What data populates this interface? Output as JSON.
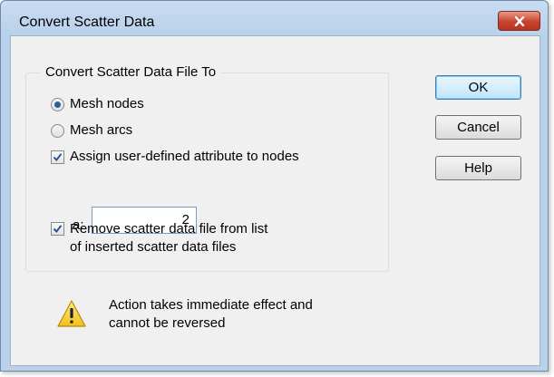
{
  "window": {
    "title": "Convert Scatter Data"
  },
  "group": {
    "title": "Convert Scatter Data File To"
  },
  "options": {
    "mesh_nodes": {
      "label": "Mesh nodes",
      "selected": true
    },
    "mesh_arcs": {
      "label": "Mesh arcs",
      "selected": false
    },
    "assign_attribute": {
      "label": "Assign user-defined attribute to nodes",
      "checked": true
    },
    "attribute_a": {
      "label": "a:",
      "value": "2"
    },
    "remove_file": {
      "line1": "Remove scatter data file from  list",
      "line2": "of inserted scatter data files",
      "checked": true
    }
  },
  "buttons": {
    "ok": "OK",
    "cancel": "Cancel",
    "help": "Help"
  },
  "warning": {
    "icon": "warning-icon",
    "line1": "Action takes immediate effect and",
    "line2": "cannot be reversed"
  },
  "colors": {
    "title_bar": "#b9d1ea",
    "close_button": "#c7432f",
    "dialog_bg": "#f0f0f0"
  }
}
